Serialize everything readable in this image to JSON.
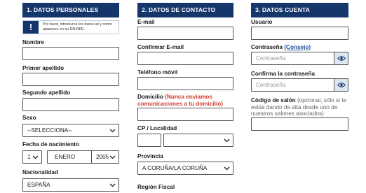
{
  "personal": {
    "header": "1. DATOS PERSONALES",
    "notice": "Por favor, introduzca los datos tal y como aparecen en su DNI/NIE.",
    "nombre_label": "Nombre",
    "apellido1_label": "Primer apellido",
    "apellido2_label": "Segundo apellido",
    "sexo_label": "Sexo",
    "sexo_value": "--SELECCIONA--",
    "fecha_label": "Fecha de nacimiento",
    "day_value": "1",
    "month_value": "ENERO",
    "year_value": "2005",
    "nacionalidad_label": "Nacionalidad",
    "nacionalidad_value": "ESPAÑA"
  },
  "contact": {
    "header": "2. DATOS DE CONTACTO",
    "email_label": "E-mail",
    "confirm_email_label": "Confirmar E-mail",
    "telefono_label": "Teléfono móvil",
    "domicilio_label": "Domicilio",
    "domicilio_note": "(Nunca enviamos comunicaciones a tu domicilio)",
    "cp_label": "CP / Localidad",
    "provincia_label": "Provincia",
    "provincia_value": "A CORUÑA/LA CORUÑA",
    "region_label": "Región Fiscal"
  },
  "account": {
    "header": "3. DATOS CUENTA",
    "usuario_label": "Usuario",
    "password_label": "Contraseña",
    "password_link": "(Consejo)",
    "password_placeholder": "Contraseña",
    "confirm_password_label": "Confirma la contraseña",
    "confirm_password_placeholder": "Contraseña",
    "salon_label": "Código de salón",
    "salon_note": "(opcional, sólo si te estás dando de alta desde uno de nuestros salones asociados)"
  },
  "colors": {
    "header_bg": "#14366b",
    "warning_red": "#d03a2b",
    "link_blue": "#1f4e9c",
    "eye_bg": "#dde6f2"
  },
  "icons": [
    "exclamation-icon",
    "chevron-down-icon",
    "eye-icon"
  ]
}
